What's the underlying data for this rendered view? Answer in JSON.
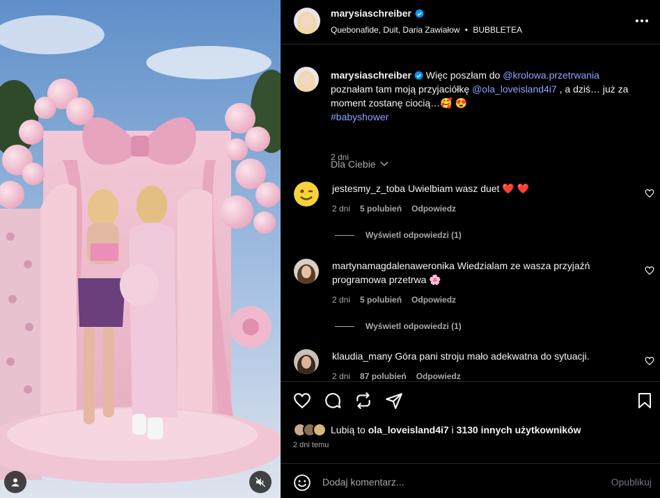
{
  "post": {
    "username": "marysiaschreiber",
    "audio_artists": "Quebonafide, Duit, Daria Zawiałow",
    "audio_separator": "•",
    "audio_track": "BUBBLETEA",
    "more_icon": "more-horizontal-icon"
  },
  "caption": {
    "username": "marysiaschreiber",
    "text_1": " Więc poszłam do ",
    "mention_1": "@krolowa.przetrwania",
    "text_2": " poznałam tam moją przyjaciółkę ",
    "mention_2": "@ola_loveisland4i7",
    "text_3": " , a dziś… już za moment zostanę ciocią…",
    "emojis": "🥰 😍",
    "hashtag": "#babyshower",
    "time": "2 dni"
  },
  "sort": {
    "label": "Dla Ciebie"
  },
  "comments": [
    {
      "username": "jestesmy_z_toba",
      "text": " Uwielbiam wasz duet ",
      "emoji": "❤️ ❤️",
      "time": "2 dni",
      "likes": "5 polubień",
      "reply": "Odpowiedz",
      "view_replies": "Wyświetl odpowiedzi (1)"
    },
    {
      "username": "martynamagdalenaweronika",
      "text": " Wiedzialam ze wasza przyjaźń programowa przetrwa ",
      "emoji": "🌸",
      "time": "2 dni",
      "likes": "5 polubień",
      "reply": "Odpowiedz",
      "view_replies": "Wyświetl odpowiedzi (1)"
    },
    {
      "username": "klaudia_many",
      "text": " Góra pani stroju mało adekwatna do sytuacji.",
      "emoji": "",
      "time": "2 dni",
      "likes": "87 polubień",
      "reply": "Odpowiedz"
    }
  ],
  "likes": {
    "prefix": "Lubią to ",
    "user": "ola_loveisland4i7",
    "middle": " i ",
    "count_text": "3130 innych użytkowników"
  },
  "time_ago": "2 dni temu",
  "comment_box": {
    "placeholder": "Dodaj komentarz...",
    "publish": "Opublikuj"
  },
  "colors": {
    "background": "#000000",
    "link": "#8ea2ff",
    "secondary_text": "#a8a8a8",
    "verified": "#0095f6"
  }
}
